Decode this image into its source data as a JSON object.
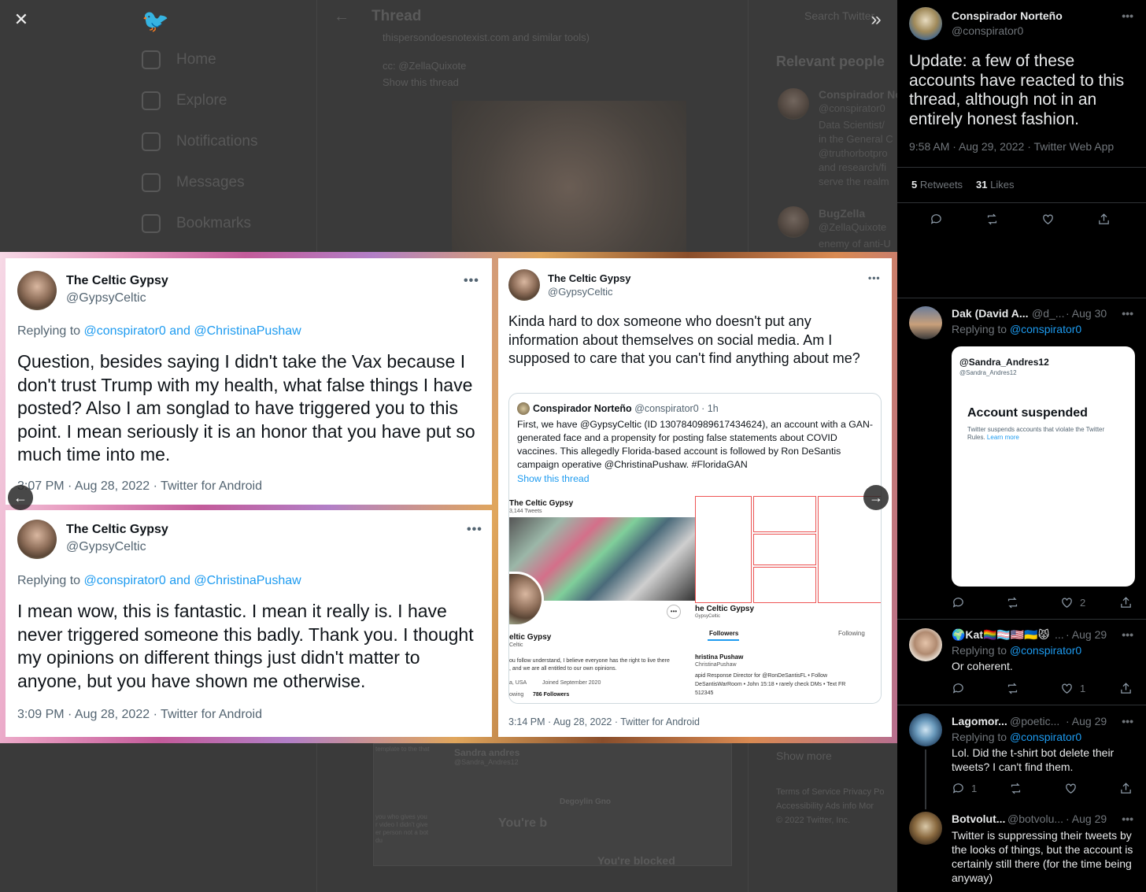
{
  "background": {
    "thread_title": "Thread",
    "nav": [
      "Home",
      "Explore",
      "Notifications",
      "Messages",
      "Bookmarks"
    ],
    "search_placeholder": "Search Twitter",
    "snippet_top": "thispersondoesnotexist.com and similar tools)",
    "cc_line": "cc: @ZellaQuixote",
    "show_thread": "Show this thread",
    "relevant_people": "Relevant people",
    "rp1_name": "Conspirador No",
    "rp1_handle": "@conspirator0",
    "rp1_bio": [
      "Data Scientist/",
      "in the General C",
      "@truthorbotpro",
      "and research/fi",
      "serve the realm"
    ],
    "rp2_name": "BugZella",
    "rp2_handle": "@ZellaQuixote",
    "rp2_bio": [
      "enemy of anti-U"
    ],
    "show_more": "Show more",
    "footer1": "Terms of Service   Privacy Po",
    "footer2": "Accessibility   Ads info   Mor",
    "footer3": "© 2022 Twitter, Inc.",
    "lower_sandra": "Sandra andres",
    "lower_sandra_handle": "@Sandra_Andres12",
    "lower_template": "template to the that",
    "lower_youre_b": "You're b",
    "lower_degoylin": "Degoylin Gno",
    "lower_youre_blocked": "You're blocked",
    "lower_snippet": [
      "you who gives you",
      "r video I didn't give",
      "er person not a bot",
      "du"
    ]
  },
  "collage": {
    "tweet1": {
      "name": "The Celtic Gypsy",
      "handle": "@GypsyCeltic",
      "reply_prefix": "Replying to",
      "reply_links": "@conspirator0 and @ChristinaPushaw",
      "text": "Question, besides saying I didn't take the Vax because I don't trust Trump with my health, what false things I have posted? Also I am songlad to have triggered you to this point. I mean seriously it is an honor that you have put so much time into me.",
      "meta": "3:07 PM · Aug 28, 2022 · Twitter for Android"
    },
    "tweet2": {
      "name": "The Celtic Gypsy",
      "handle": "@GypsyCeltic",
      "reply_prefix": "Replying to",
      "reply_links": "@conspirator0 and @ChristinaPushaw",
      "text": "I mean wow, this is fantastic. I mean it really is. I have never triggered someone this badly. Thank you. I thought my opinions on different things just didn't matter to anyone, but you have shown me otherwise.",
      "meta": "3:09 PM · Aug 28, 2022 · Twitter for Android"
    },
    "tweet3": {
      "name": "The Celtic Gypsy",
      "handle": "@GypsyCeltic",
      "text": "Kinda hard to dox someone who doesn't put any information about themselves on social media. Am I supposed to care that you can't find anything about me?",
      "meta": "3:14 PM · Aug 28, 2022 · Twitter for Android",
      "quote": {
        "name": "Conspirador Norteño",
        "handle_time": "@conspirator0 · 1h",
        "text": "First, we have @GypsyCeltic (ID 1307840989617434624), an account with a GAN-generated face and a propensity for posting false statements about COVID vaccines. This allegedly Florida-based account is followed by Ron DeSantis campaign operative @ChristinaPushaw. #FloridaGAN",
        "show_thread": "Show this thread",
        "img1_name": "The Celtic Gypsy",
        "img1_tweets": "3,144 Tweets",
        "img1_name2": "eltic Gypsy",
        "img1_handle2": "Celtic",
        "img1_bio": "ou follow understand, I believe everyone has the right to live there",
        "img1_bio2": ", and we are all entitled to our own opinions.",
        "img1_loc": "a, USA",
        "img1_joined": "Joined September 2020",
        "img1_following": "owing",
        "img1_followers": "786 Followers",
        "img2_name": "he Celtic Gypsy",
        "img2_handle": "GypsyCeltic",
        "img2_tab1": "Followers",
        "img2_tab2": "Following",
        "img2_user": "hristina Pushaw",
        "img2_user_handle": "ChristinaPushaw",
        "img2_bio": "apid Response Director for @RonDeSantisFL • Follow",
        "img2_bio2": "DeSantisWarRoom • John 15:18 • rarely check DMs • Text FR",
        "img2_bio3": "512345"
      }
    },
    "prev_arrow": "←",
    "next_arrow": "→"
  },
  "controls": {
    "close": "✕",
    "expand": "»"
  },
  "panel": {
    "main": {
      "name": "Conspirador Norteño",
      "handle": "@conspirator0",
      "text": "Update: a few of these accounts have reacted to this thread, although not in an entirely honest fashion.",
      "meta": "9:58 AM · Aug 29, 2022 · Twitter Web App",
      "retweets_count": "5",
      "retweets_label": "Retweets",
      "likes_count": "31",
      "likes_label": "Likes"
    },
    "replies": [
      {
        "name": "Dak (David A...",
        "handle": "@d_...",
        "time": "· Aug 30",
        "reply_prefix": "Replying to",
        "reply_to": "@conspirator0",
        "text": "",
        "card_handle": "@Sandra_Andres12",
        "card_handle_small": "@Sandra_Andres12",
        "card_title": "Account suspended",
        "card_desc": "Twitter suspends accounts that violate the Twitter Rules.",
        "card_link": "Learn more",
        "reply_count": "",
        "retweet_count": "",
        "like_count": "2"
      },
      {
        "name": "🌍Kat🏳️‍🌈🏳️‍⚧️🇺🇸🇺🇦😾",
        "handle": "...",
        "time": "· Aug 29",
        "reply_prefix": "Replying to",
        "reply_to": "@conspirator0",
        "text": "Or coherent.",
        "reply_count": "",
        "retweet_count": "",
        "like_count": "1"
      },
      {
        "name": "Lagomor...",
        "handle": "@poetic...",
        "time": "· Aug 29",
        "reply_prefix": "Replying to",
        "reply_to": "@conspirator0",
        "text": "Lol. Did the t-shirt bot delete their tweets? I can't find them.",
        "reply_count": "1",
        "retweet_count": "",
        "like_count": ""
      },
      {
        "name": "Botvolut...",
        "handle": "@botvolu...",
        "time": "· Aug 29",
        "text": "Twitter is suppressing their tweets by the looks of things, but the account is certainly still there (for the time being anyway)"
      }
    ]
  }
}
